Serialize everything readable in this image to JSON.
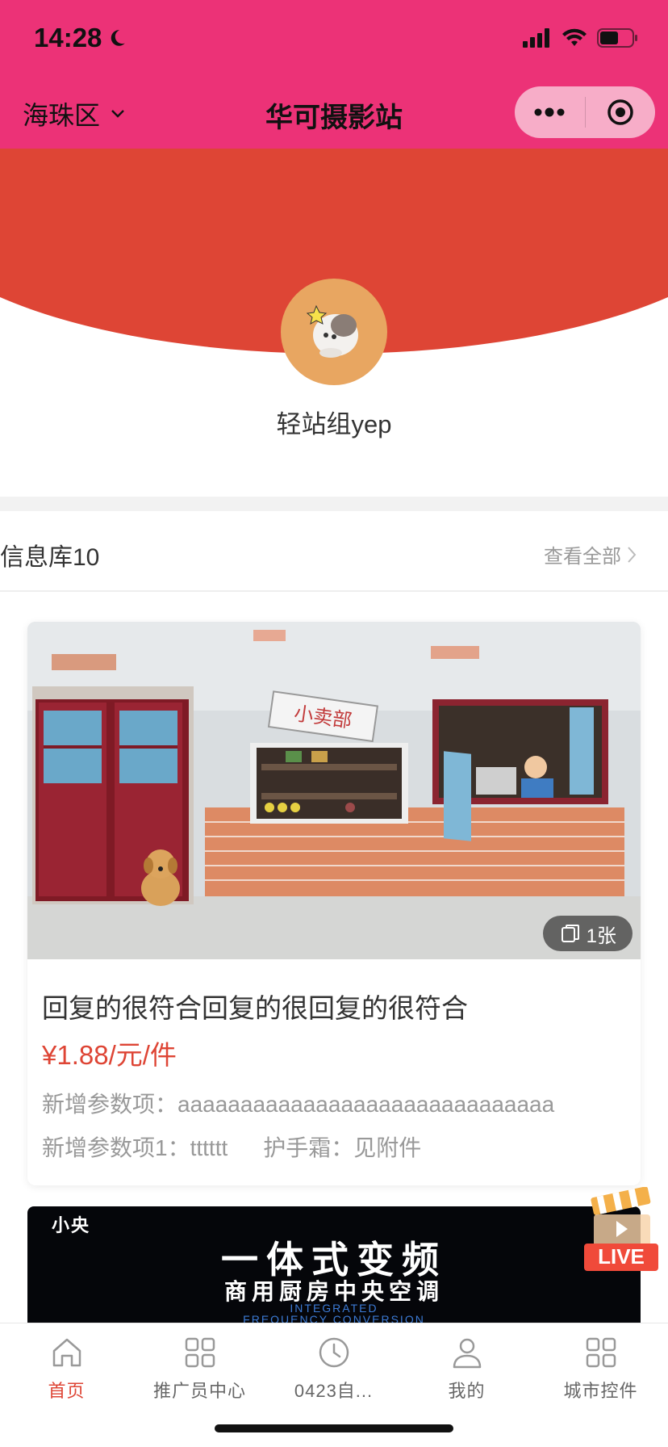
{
  "status": {
    "time": "14:28"
  },
  "nav": {
    "city": "海珠区",
    "title": "华可摄影站"
  },
  "profile": {
    "name": "轻站组yep"
  },
  "section": {
    "title": "信息库10",
    "more": "查看全部"
  },
  "card": {
    "image_count": "1张",
    "shop_sign": "小卖部",
    "title": "回复的很符合回复的很回复的很符合",
    "price": "¥1.88/元/件",
    "params": [
      {
        "label": "新增参数项：",
        "value": "aaaaaaaaaaaaaaaaaaaaaaaaaaaaaa"
      },
      {
        "label": "新增参数项1：",
        "value": "tttttt"
      },
      {
        "label": "护手霜：",
        "value": "见附件"
      }
    ]
  },
  "ad_card": {
    "brand": "小央",
    "headline": "一体式变频",
    "subline": "商用厨房中央空调",
    "english_1": "INTEGRATED",
    "english_2": "FREQUENCY CONVERSION"
  },
  "live_badge": "LIVE",
  "tabs": [
    {
      "label": "首页",
      "icon": "home-icon",
      "active": true
    },
    {
      "label": "推广员中心",
      "icon": "grid-icon",
      "active": false
    },
    {
      "label": "0423自...",
      "icon": "clock-icon",
      "active": false
    },
    {
      "label": "我的",
      "icon": "user-icon",
      "active": false
    },
    {
      "label": "城市控件",
      "icon": "grid-icon",
      "active": false
    }
  ],
  "colors": {
    "brand_pink": "#ec3277",
    "banner_red": "#de4535",
    "price_red": "#de4535"
  }
}
